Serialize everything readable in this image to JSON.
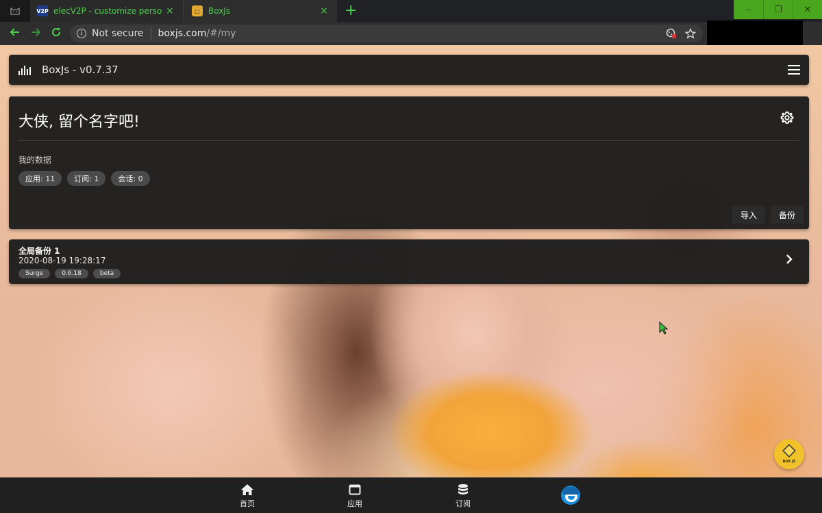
{
  "browser": {
    "tabs": [
      {
        "favicon": "V2P",
        "title": "elecV2P - customize personal",
        "close": "×"
      },
      {
        "favicon": "□",
        "title": "BoxJs",
        "close": "×"
      }
    ],
    "new_tab": "+",
    "window_controls": {
      "minimize": "–",
      "restore": "❐",
      "close": "✕"
    },
    "security_label": "Not secure",
    "url_host": "boxjs.com",
    "url_path": "/#/my",
    "accent_color": "#4fcf4f"
  },
  "app": {
    "title": "BoxJs - v0.7.37"
  },
  "profile": {
    "greeting": "大侠, 留个名字吧!",
    "section_label": "我的数据",
    "stats": [
      {
        "label": "应用: 11"
      },
      {
        "label": "订阅: 1"
      },
      {
        "label": "会话: 0"
      }
    ],
    "import_label": "导入",
    "backup_label": "备份"
  },
  "backup_entry": {
    "title": "全局备份 1",
    "time": "2020-08-19 19:28:17",
    "tags": [
      "Surge",
      "0.6.18",
      "beta"
    ]
  },
  "fab": {
    "label": "BOX JS"
  },
  "bottom_nav": {
    "items": [
      {
        "label": "首页",
        "icon": "home-icon"
      },
      {
        "label": "应用",
        "icon": "window-icon"
      },
      {
        "label": "订阅",
        "icon": "database-icon"
      }
    ],
    "avatar": "avatar-icon"
  }
}
